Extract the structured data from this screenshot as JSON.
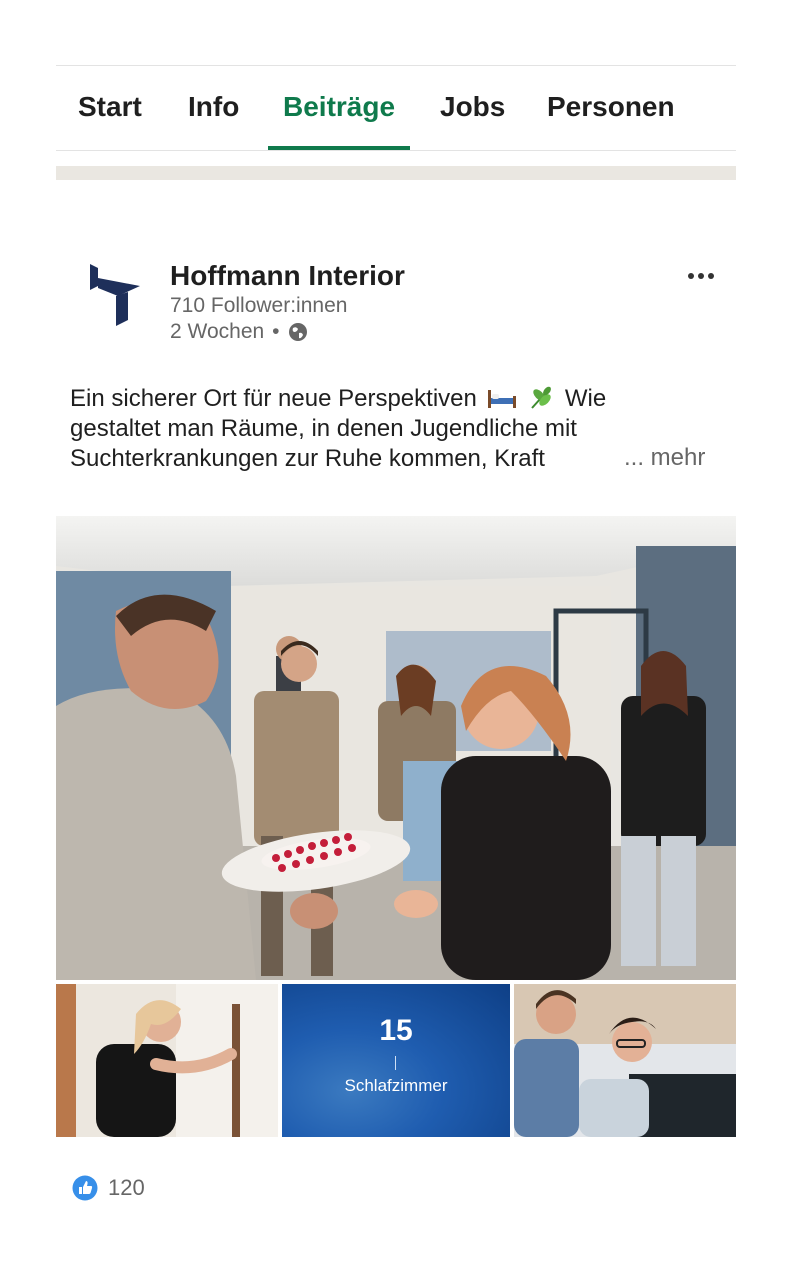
{
  "tabs": [
    {
      "label": "Start"
    },
    {
      "label": "Info"
    },
    {
      "label": "Beiträge",
      "active": true
    },
    {
      "label": "Jobs"
    },
    {
      "label": "Personen"
    }
  ],
  "post": {
    "company": "Hoffmann Interior",
    "followers": "710 Follower:innen",
    "time": "2 Wochen",
    "time_separator": "•",
    "text_lines": [
      "Ein sicherer Ort für neue Perspektiven",
      "Wie",
      "gestaltet man Räume, in denen Jugendliche mit",
      "Suchterkrankungen zur Ruhe kommen, Kraft"
    ],
    "more_label": "... mehr",
    "thumb_count": "15",
    "thumb_label": "Schlafzimmer",
    "likes": "120"
  },
  "colors": {
    "accent": "#0f7a4c",
    "logo": "#1e2f5a",
    "like": "#378fe9"
  },
  "icons": [
    "more-options-icon",
    "globe-icon",
    "bed-emoji-icon",
    "herb-emoji-icon",
    "like-reaction-icon"
  ]
}
